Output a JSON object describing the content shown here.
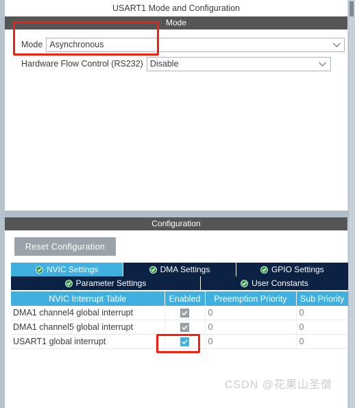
{
  "window": {
    "title": "USART1 Mode and Configuration"
  },
  "mode_section": {
    "header": "Mode",
    "fields": [
      {
        "label": "Mode",
        "value": "Asynchronous"
      },
      {
        "label": "Hardware Flow Control (RS232)",
        "value": "Disable"
      }
    ]
  },
  "configuration_section": {
    "header": "Configuration",
    "reset_button": "Reset Configuration",
    "tabs_row1": [
      {
        "label": "NVIC Settings",
        "active": true
      },
      {
        "label": "DMA Settings",
        "active": false
      },
      {
        "label": "GPIO Settings",
        "active": false
      }
    ],
    "tabs_row2": [
      {
        "label": "Parameter Settings",
        "active": false
      },
      {
        "label": "User Constants",
        "active": false
      }
    ],
    "table": {
      "columns": [
        "NVIC Interrupt Table",
        "Enabled",
        "Preemption Priority",
        "Sub Priority"
      ],
      "rows": [
        {
          "name": "DMA1 channel4 global interrupt",
          "enabled": true,
          "enabled_state": "disabled",
          "preemption_priority": "0",
          "sub_priority": "0"
        },
        {
          "name": "DMA1 channel5 global interrupt",
          "enabled": true,
          "enabled_state": "disabled",
          "preemption_priority": "0",
          "sub_priority": "0"
        },
        {
          "name": "USART1 global interrupt",
          "enabled": true,
          "enabled_state": "on",
          "preemption_priority": "0",
          "sub_priority": "0"
        }
      ]
    }
  },
  "annotations": [
    {
      "id": "mode-field-highlight",
      "color": "#fc1c0c"
    },
    {
      "id": "usart1-enabled-highlight",
      "color": "#fc1c0c"
    }
  ],
  "watermark": "CSDN @花果山圣僧",
  "icons": {
    "chevron_down": "chevron-down-icon",
    "tab_check": "green-check-circle-icon",
    "checkbox_check": "checkmark-icon"
  },
  "colors": {
    "accent_blue": "#3fb0e0",
    "tab_dark": "#0b2244",
    "section_bar": "#555555",
    "annotation_red": "#fc1c0c"
  }
}
